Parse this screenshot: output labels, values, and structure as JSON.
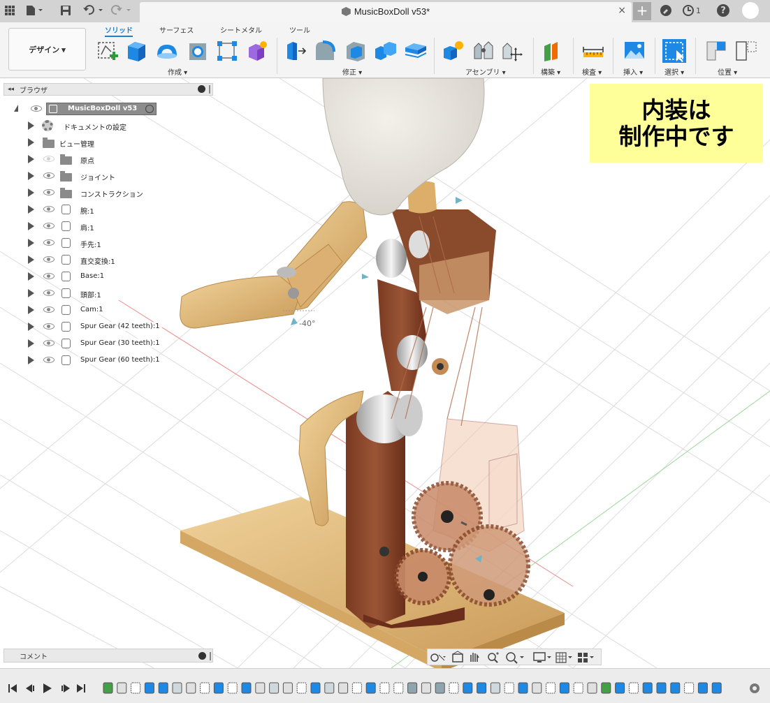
{
  "titlebar": {
    "document_title": "MusicBoxDoll v53*",
    "close_glyph": "×",
    "new_tab_glyph": "+",
    "job_count": "1",
    "help_glyph": "?"
  },
  "toolbar": {
    "workspace_label": "デザイン ▾",
    "tabs": [
      "ソリッド",
      "サーフェス",
      "シートメタル",
      "ツール"
    ],
    "groups": [
      "作成 ▾",
      "修正 ▾",
      "アセンブリ ▾",
      "構築 ▾",
      "検査 ▾",
      "挿入 ▾",
      "選択 ▾",
      "位置 ▾"
    ]
  },
  "browser": {
    "title": "ブラウザ",
    "root": "MusicBoxDoll v53",
    "items": [
      {
        "label": "ドキュメントの設定",
        "icon": "gear-icon"
      },
      {
        "label": "ビュー管理",
        "icon": "folder-icon"
      },
      {
        "label": "原点",
        "icon": "folder-icon"
      },
      {
        "label": "ジョイント",
        "icon": "folder-icon"
      },
      {
        "label": "コンストラクション",
        "icon": "folder-icon"
      },
      {
        "label": "腕:1",
        "icon": "body-icon"
      },
      {
        "label": "肩:1",
        "icon": "body-icon"
      },
      {
        "label": "手先:1",
        "icon": "body-icon"
      },
      {
        "label": "直交変換:1",
        "icon": "body-icon"
      },
      {
        "label": "Base:1",
        "icon": "body-icon"
      },
      {
        "label": "頭部:1",
        "icon": "body-icon"
      },
      {
        "label": "Cam:1",
        "icon": "body-icon"
      },
      {
        "label": "Spur Gear (42 teeth):1",
        "icon": "body-icon"
      },
      {
        "label": "Spur Gear (30 teeth):1",
        "icon": "body-icon"
      },
      {
        "label": "Spur Gear (60 teeth):1",
        "icon": "body-icon"
      }
    ]
  },
  "note": {
    "line1": "内装は",
    "line2": "制作中です"
  },
  "viewport": {
    "angle_label": "-40°"
  },
  "comment_panel": {
    "title": "コメント"
  },
  "colors": {
    "accent": "#1a7fd3",
    "wood_light": "#e6c48a",
    "wood_dark": "#8a4a2c",
    "note_bg": "#ffff99"
  }
}
